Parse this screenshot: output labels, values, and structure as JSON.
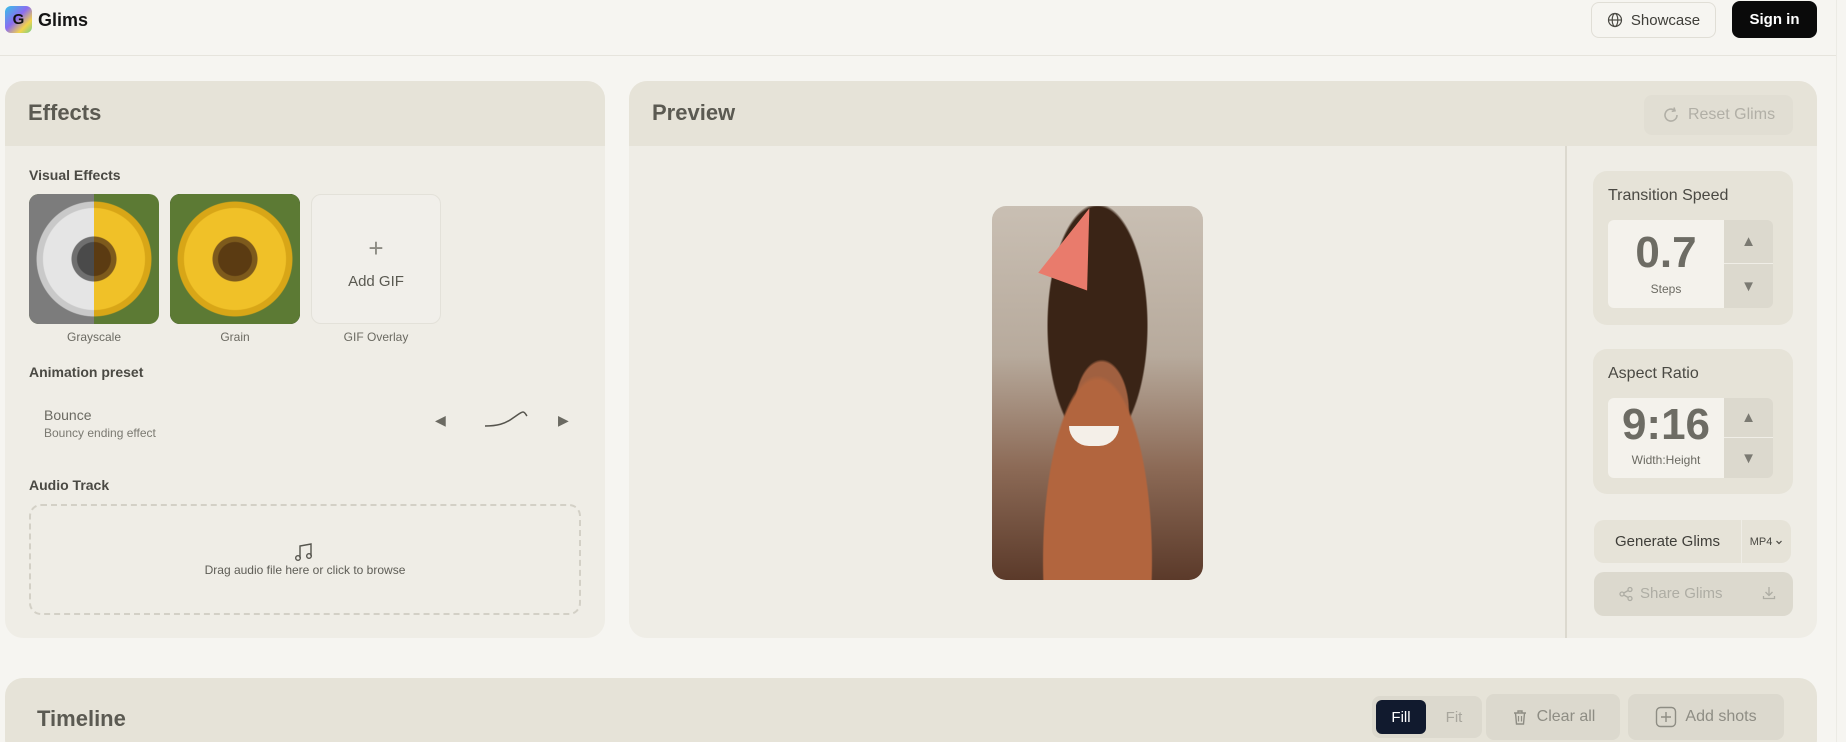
{
  "header": {
    "brand": "Glims",
    "logo_letter": "G",
    "showcase_label": "Showcase",
    "signin_label": "Sign in"
  },
  "effects": {
    "title": "Effects",
    "visual_effects_label": "Visual Effects",
    "thumbnails": [
      {
        "caption": "Grayscale",
        "selected": false
      },
      {
        "caption": "Grain",
        "selected": true
      },
      {
        "caption": "GIF Overlay",
        "selected": false
      }
    ],
    "add_gif_label": "Add GIF",
    "add_gif_symbol": "+",
    "animation_preset_label": "Animation preset",
    "preset": {
      "name": "Bounce",
      "description": "Bouncy ending effect"
    },
    "audio_track_label": "Audio Track",
    "dropzone_text": "Drag audio file here or click to browse",
    "arrow_prev": "◀",
    "arrow_next": "▶"
  },
  "preview": {
    "title": "Preview",
    "reset_label": "Reset Glims",
    "transition_speed": {
      "title": "Transition Speed",
      "value": "0.7",
      "unit": "Steps"
    },
    "aspect_ratio": {
      "title": "Aspect Ratio",
      "value": "9:16",
      "unit": "Width:Height"
    },
    "stepper_up": "▲",
    "stepper_down": "▼",
    "generate_label": "Generate Glims",
    "format_label": "MP4",
    "share_label": "Share Glims"
  },
  "timeline": {
    "title": "Timeline",
    "fill_label": "Fill",
    "fit_label": "Fit",
    "clear_label": "Clear all",
    "add_shots_label": "Add shots"
  },
  "colors": {
    "background": "#f6f5f1",
    "panel": "#efede6",
    "panel_header": "#e6e3d8",
    "primary_button": "#0a0a0a",
    "toggle_active": "#111a2e"
  }
}
